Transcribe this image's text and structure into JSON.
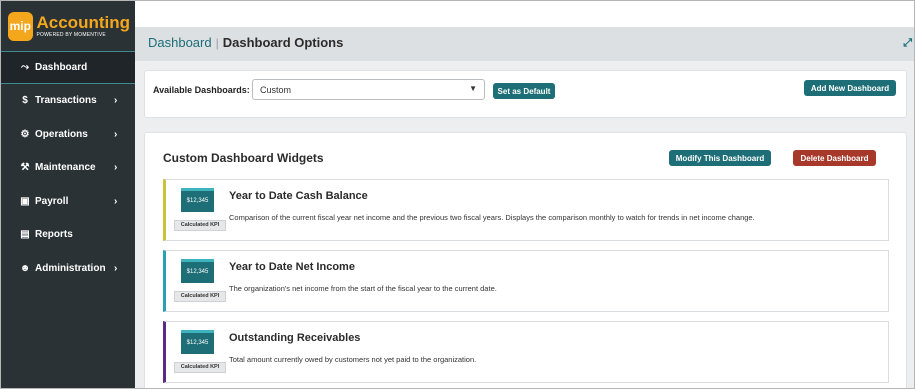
{
  "logo": {
    "badge": "mip",
    "title": "Accounting",
    "subtitle": "POWERED BY MOMENTIVE"
  },
  "sidebar": {
    "items": [
      {
        "label": "Dashboard",
        "icon": "chart-line-icon",
        "glyph": "⤳",
        "active": true,
        "has_children": false
      },
      {
        "label": "Transactions",
        "icon": "dollar-icon",
        "glyph": "$",
        "active": false,
        "has_children": true
      },
      {
        "label": "Operations",
        "icon": "cogs-icon",
        "glyph": "⚙",
        "active": false,
        "has_children": true
      },
      {
        "label": "Maintenance",
        "icon": "wrench-icon",
        "glyph": "⚒",
        "active": false,
        "has_children": true
      },
      {
        "label": "Payroll",
        "icon": "money-bill-icon",
        "glyph": "▣",
        "active": false,
        "has_children": true
      },
      {
        "label": "Reports",
        "icon": "file-icon",
        "glyph": "▤",
        "active": false,
        "has_children": false
      },
      {
        "label": "Administration",
        "icon": "users-icon",
        "glyph": "☻",
        "active": false,
        "has_children": true
      }
    ],
    "chevron": "›"
  },
  "header": {
    "crumb_link": "Dashboard",
    "separator": "|",
    "crumb_current": "Dashboard Options",
    "expand_glyph": "⤢"
  },
  "options": {
    "available_label": "Available Dashboards:",
    "select_value": "Custom",
    "select_arrow": "▼",
    "set_default_label": "Set as Default",
    "add_new_label": "Add New Dashboard"
  },
  "widgets_panel": {
    "title": "Custom Dashboard Widgets",
    "modify_label": "Modify This Dashboard",
    "delete_label": "Delete Dashboard",
    "kpi_value": "$12,345",
    "kpi_badge": "Calculated KPI",
    "widgets": [
      {
        "title": "Year to Date Cash Balance",
        "description": "Comparison of the current fiscal year net income and the previous two fiscal years. Displays the comparison monthly to watch for trends in net income change.",
        "accent": "#c9c23a"
      },
      {
        "title": "Year to Date Net Income",
        "description": "The organization's net income from the start of the fiscal year to the current date.",
        "accent": "#2b9fb3"
      },
      {
        "title": "Outstanding Receivables",
        "description": "Total amount currently owed by customers not yet paid to the organization.",
        "accent": "#5b2a86"
      }
    ]
  },
  "colors": {
    "accent": "#1d6e76",
    "danger": "#a8382a",
    "brand": "#f4a71d",
    "sidebar": "#2b3236"
  }
}
